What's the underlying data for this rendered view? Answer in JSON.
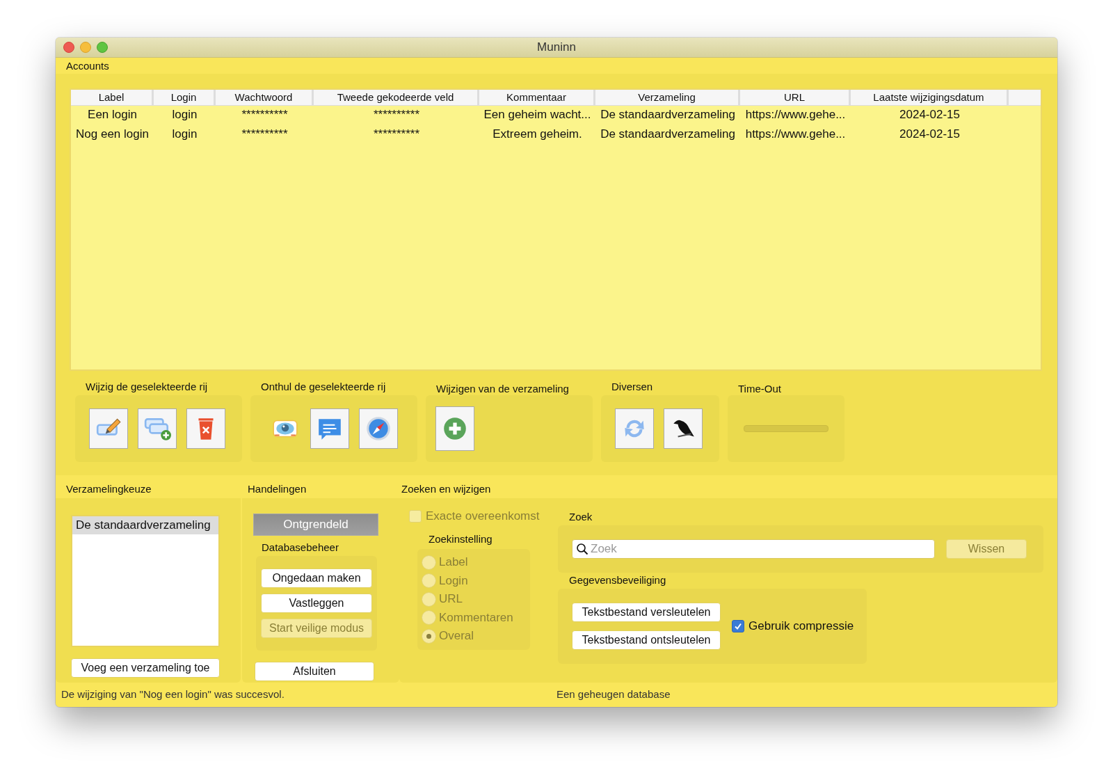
{
  "window": {
    "title": "Muninn"
  },
  "accounts": {
    "title": "Accounts",
    "table": {
      "columns": [
        "Label",
        "Login",
        "Wachtwoord",
        "Tweede gekodeerde veld",
        "Kommentaar",
        "Verzameling",
        "URL",
        "Laatste wijzigingsdatum"
      ],
      "rows": [
        {
          "selected": false,
          "cells": [
            "Een login",
            "login",
            "**********",
            "**********",
            "Een geheim wacht...",
            "De standaardverzameling",
            "https://www.gehe...",
            "2024-02-15"
          ]
        },
        {
          "selected": false,
          "cells": [
            "Nog een login",
            "login",
            "**********",
            "**********",
            "Extreem geheim.",
            "De standaardverzameling",
            "https://www.gehe...",
            "2024-02-15"
          ]
        }
      ]
    }
  },
  "toolbar_groups": [
    {
      "title": "Wijzig de geselekteerde rij",
      "kind": "buttons"
    },
    {
      "title": "Onthul de geselekteerde rij",
      "kind": "buttons"
    },
    {
      "title": "Wijzigen van de verzameling",
      "kind": "buttons"
    },
    {
      "title": "Diversen",
      "kind": "buttons"
    },
    {
      "title": "Time-Out",
      "kind": "progress",
      "level": 0
    }
  ],
  "collections": {
    "title": "Verzamelingkeuze",
    "items": [
      {
        "label": "De standaardverzameling",
        "selected": true
      }
    ],
    "add_button": "Voeg een verzameling toe"
  },
  "actions": {
    "title": "Handelingen",
    "lock_button": {
      "label": "Ontgrendeld",
      "pressed": true
    },
    "database": {
      "title": "Databasebeheer",
      "buttons": [
        {
          "label": "Ongedaan maken",
          "disabled": false
        },
        {
          "label": "Vastleggen",
          "disabled": false
        },
        {
          "label": "Start veilige modus",
          "disabled": true
        }
      ]
    },
    "quit_button": "Afsluiten"
  },
  "search_edit": {
    "title": "Zoeken en wijzigen",
    "exact_match": {
      "label": "Exacte overeenkomst",
      "checked": false,
      "disabled": true
    },
    "search_setting": {
      "title": "Zoekinstelling",
      "disabled": true,
      "options": [
        {
          "label": "Label",
          "selected": false
        },
        {
          "label": "Login",
          "selected": false
        },
        {
          "label": "URL",
          "selected": false
        },
        {
          "label": "Kommentaren",
          "selected": false
        },
        {
          "label": "Overal",
          "selected": true
        }
      ]
    },
    "search": {
      "title": "Zoek",
      "placeholder": "Zoek",
      "clear_button": {
        "label": "Wissen",
        "disabled": true
      }
    },
    "data_security": {
      "title": "Gegevensbeveiliging",
      "buttons": [
        "Tekstbestand versleutelen",
        "Tekstbestand ontsleutelen"
      ],
      "compression": {
        "label": "Gebruik compressie",
        "checked": true
      }
    }
  },
  "status_bar": {
    "message": "De wijziging van \"Nog een login\" was succesvol.",
    "database": "Een geheugen database"
  }
}
